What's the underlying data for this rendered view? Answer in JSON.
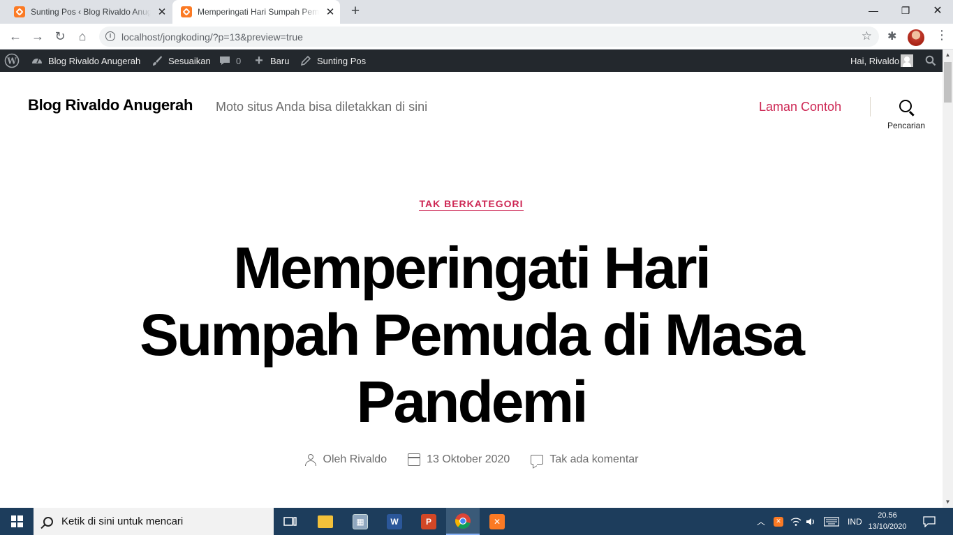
{
  "browser": {
    "tabs": [
      {
        "title": "Sunting Pos ‹ Blog Rivaldo Anugerah — WordPress"
      },
      {
        "title": "Memperingati Hari Sumpah Pemuda di Masa Pandemi"
      }
    ],
    "url": "localhost/jongkoding/?p=13&preview=true"
  },
  "adminbar": {
    "site_name": "Blog Rivaldo Anugerah",
    "customize": "Sesuaikan",
    "comments_count": "0",
    "new": "Baru",
    "edit_post": "Sunting Pos",
    "greeting": "Hai, Rivaldo"
  },
  "site": {
    "title": "Blog Rivaldo Anugerah",
    "description": "Moto situs Anda bisa diletakkan di sini",
    "menu_item": "Laman Contoh",
    "search_label": "Pencarian"
  },
  "post": {
    "category": "TAK BERKATEGORI",
    "title": "Memperingati Hari Sumpah Pemuda di Masa Pandemi",
    "author": "Oleh Rivaldo",
    "date": "13 Oktober 2020",
    "comments": "Tak ada komentar"
  },
  "taskbar": {
    "search_placeholder": "Ketik di sini untuk mencari",
    "language": "IND",
    "time": "20.56",
    "date": "13/10/2020"
  },
  "colors": {
    "accent": "#cd2653",
    "adminbar": "#23282d",
    "taskbar": "#1d3d5c"
  }
}
